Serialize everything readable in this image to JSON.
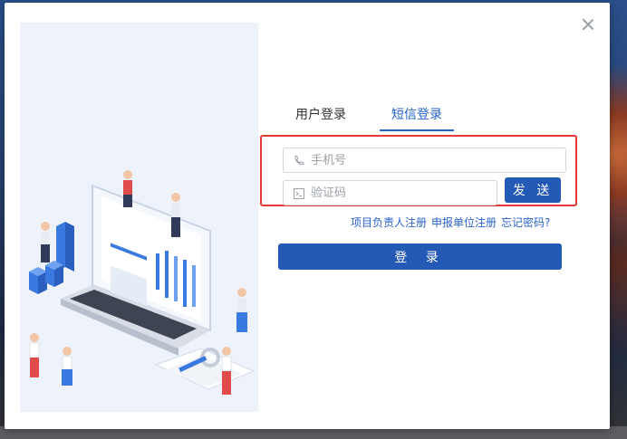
{
  "tabs": [
    {
      "label": "用户登录",
      "active": false
    },
    {
      "label": "短信登录",
      "active": true
    }
  ],
  "phone_field": {
    "placeholder": "手机号",
    "icon": "phone-icon"
  },
  "code_field": {
    "placeholder": "验证码",
    "icon": "code-icon"
  },
  "send_button": {
    "label": "发 送"
  },
  "links": {
    "register_project": "项目负责人注册",
    "register_unit": "申报单位注册",
    "forgot_password": "忘记密码?"
  },
  "login_button": {
    "label": "登 录"
  },
  "close_icon": "close-icon",
  "colors": {
    "primary": "#2459b5",
    "link": "#2a62c9",
    "highlight": "#e53935"
  }
}
